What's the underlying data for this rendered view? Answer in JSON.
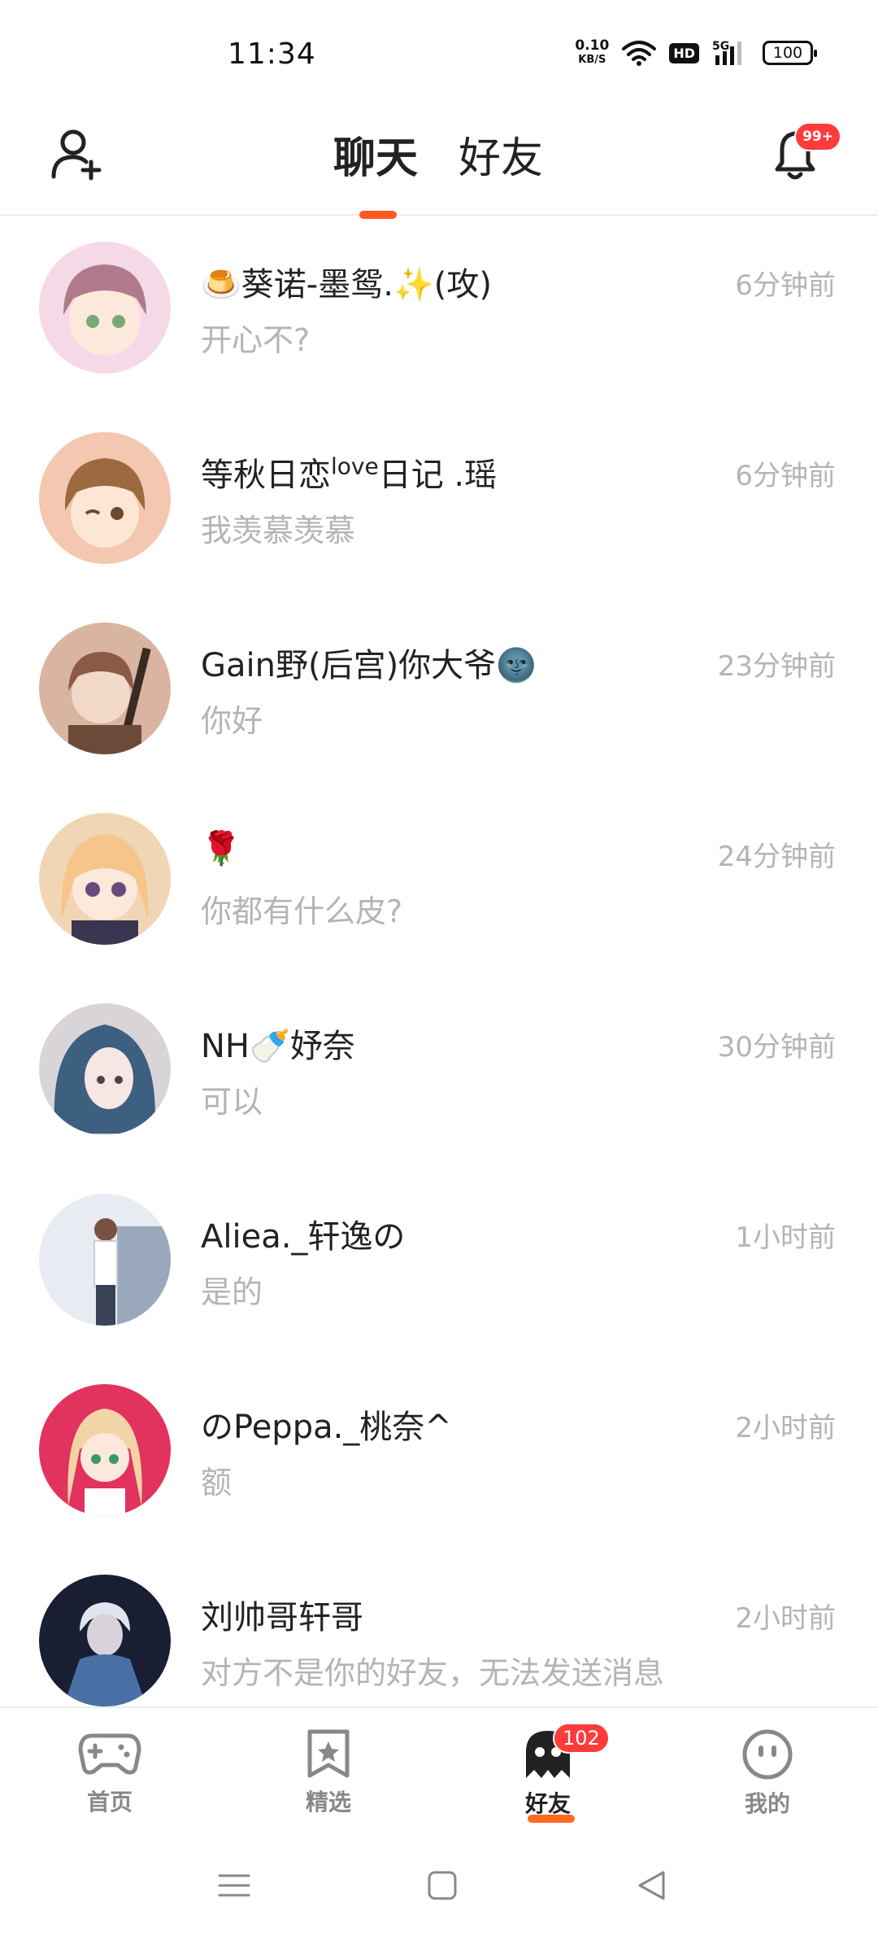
{
  "status_bar": {
    "time": "11:34",
    "net_speed_value": "0.10",
    "net_speed_unit": "KB/S",
    "hd_label": "HD",
    "network_label": "5G",
    "battery": "100"
  },
  "header": {
    "tabs": [
      {
        "label": "聊天",
        "active": true
      },
      {
        "label": "好友",
        "active": false
      }
    ],
    "notification_badge": "99+"
  },
  "chats": [
    {
      "name": "🍮葵诺-墨鸳.✨(攻)",
      "time": "6分钟前",
      "message": "开心不?",
      "avatar_colors": [
        "#f6d9e6",
        "#b07a8c"
      ]
    },
    {
      "name_pre": "等秋日恋",
      "name_sup": "love",
      "name_post": "日记 .瑶",
      "time": "6分钟前",
      "message": "我羡慕羡慕",
      "avatar_colors": [
        "#f4c7b0",
        "#9b6a3e"
      ]
    },
    {
      "name": "Gain野(后宫)你大爷🌚",
      "time": "23分钟前",
      "message": "你好",
      "avatar_colors": [
        "#d9b4a0",
        "#6b4a3a"
      ]
    },
    {
      "name": "🌹",
      "time": "24分钟前",
      "message": "你都有什么皮?",
      "avatar_colors": [
        "#f5c58a",
        "#3a3550"
      ]
    },
    {
      "name": "NH🍼妤奈",
      "time": "30分钟前",
      "message": "可以",
      "avatar_colors": [
        "#3d5f80",
        "#d9d4d8"
      ]
    },
    {
      "name": "Aliea._轩逸の",
      "time": "1小时前",
      "message": "是的",
      "avatar_colors": [
        "#e8ecf2",
        "#6b7a8e"
      ]
    },
    {
      "name": "のPeppa._桃奈^",
      "time": "2小时前",
      "message": "额",
      "avatar_colors": [
        "#e2325e",
        "#f3d3a8"
      ]
    },
    {
      "name": "刘帅哥轩哥",
      "time": "2小时前",
      "message": "对方不是你的好友，无法发送消息",
      "avatar_colors": [
        "#1a1e33",
        "#4a6fa5"
      ]
    }
  ],
  "bottom_nav": [
    {
      "label": "首页",
      "icon": "gamepad-icon",
      "active": false
    },
    {
      "label": "精选",
      "icon": "star-bookmark-icon",
      "active": false
    },
    {
      "label": "好友",
      "icon": "ghost-icon",
      "active": true,
      "badge": "102"
    },
    {
      "label": "我的",
      "icon": "face-icon",
      "active": false
    }
  ],
  "colors": {
    "accent": "#ff5a1f",
    "badge": "#ff3b3b",
    "muted_text": "#b4b4b4"
  }
}
